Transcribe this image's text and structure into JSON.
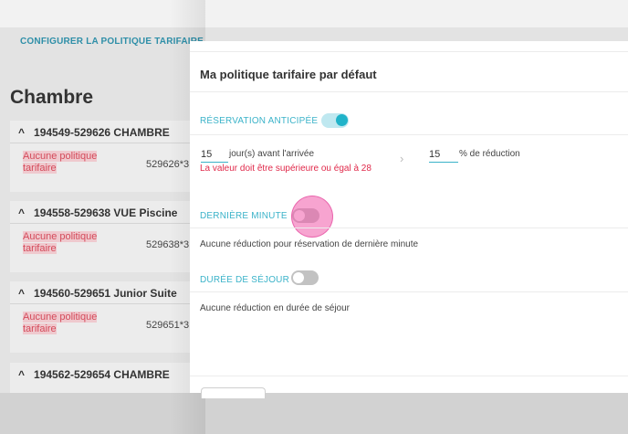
{
  "background": {
    "config_link": "CONFIGURER LA POLITIQUE TARIFAIRE",
    "section_title": "Chambre",
    "rooms": [
      {
        "title": "194549-529626 CHAMBRE",
        "policy": "Aucune politique tarifaire",
        "code": "529626*3"
      },
      {
        "title": "194558-529638 VUE Piscine",
        "policy": "Aucune politique tarifaire",
        "code": "529638*3"
      },
      {
        "title": "194560-529651 Junior Suite",
        "policy": "Aucune politique tarifaire",
        "code": "529651*3"
      },
      {
        "title": "194562-529654 CHAMBRE",
        "policy": "",
        "code": ""
      }
    ]
  },
  "panel": {
    "title": "Ma politique tarifaire par défaut",
    "early_booking": {
      "label": "RÉSERVATION ANTICIPÉE",
      "enabled": true,
      "days_value": "15",
      "days_suffix": "jour(s) avant l'arrivée",
      "error": "La valeur doit être supérieure ou égal à 28",
      "arrow": "›",
      "discount_value": "15",
      "discount_suffix": "% de réduction"
    },
    "last_minute": {
      "label": "DERNIÈRE MINUTE",
      "enabled": false,
      "description": "Aucune réduction pour réservation de dernière minute"
    },
    "length_of_stay": {
      "label": "DURÉE DE SÉJOUR",
      "enabled": false,
      "description": "Aucune réduction en durée de séjour"
    }
  },
  "colors": {
    "accent": "#3bb3c9",
    "error": "#e0294a",
    "click_indicator": "#f05aaa"
  }
}
